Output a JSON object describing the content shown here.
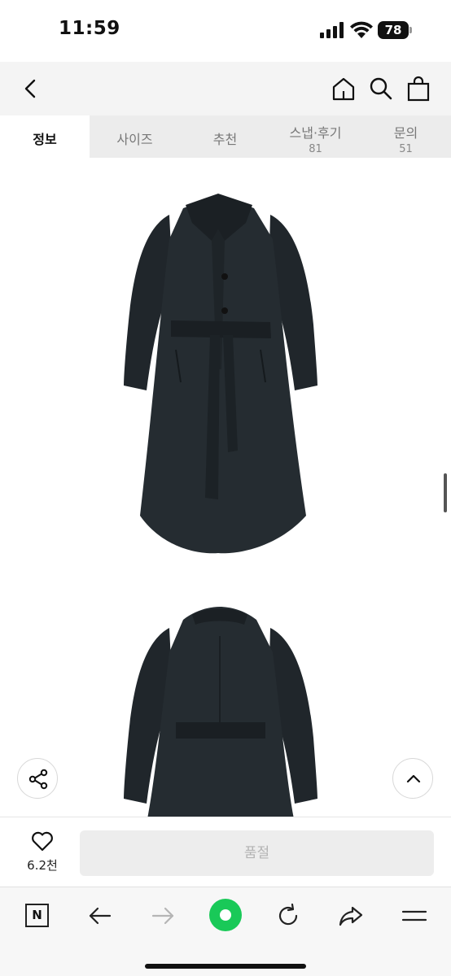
{
  "status_bar": {
    "time": "11:59",
    "battery": "78"
  },
  "tabs": [
    {
      "label": "정보",
      "count": null,
      "active": true
    },
    {
      "label": "사이즈",
      "count": null,
      "active": false
    },
    {
      "label": "추천",
      "count": null,
      "active": false
    },
    {
      "label": "스냅·후기",
      "count": "81",
      "active": false
    },
    {
      "label": "문의",
      "count": "51",
      "active": false
    }
  ],
  "purchase": {
    "like_count": "6.2천",
    "buy_label": "품절"
  },
  "colors": {
    "accent_green": "#19c958",
    "coat": "#20262b",
    "header_bg": "#f4f4f4"
  },
  "icons": [
    "back-icon",
    "home-icon",
    "search-icon",
    "bag-icon",
    "share-icon",
    "chevron-up-icon",
    "heart-icon",
    "naver-icon",
    "arrow-left-icon",
    "arrow-right-icon",
    "refresh-icon",
    "share-arrow-icon",
    "menu-icon"
  ]
}
